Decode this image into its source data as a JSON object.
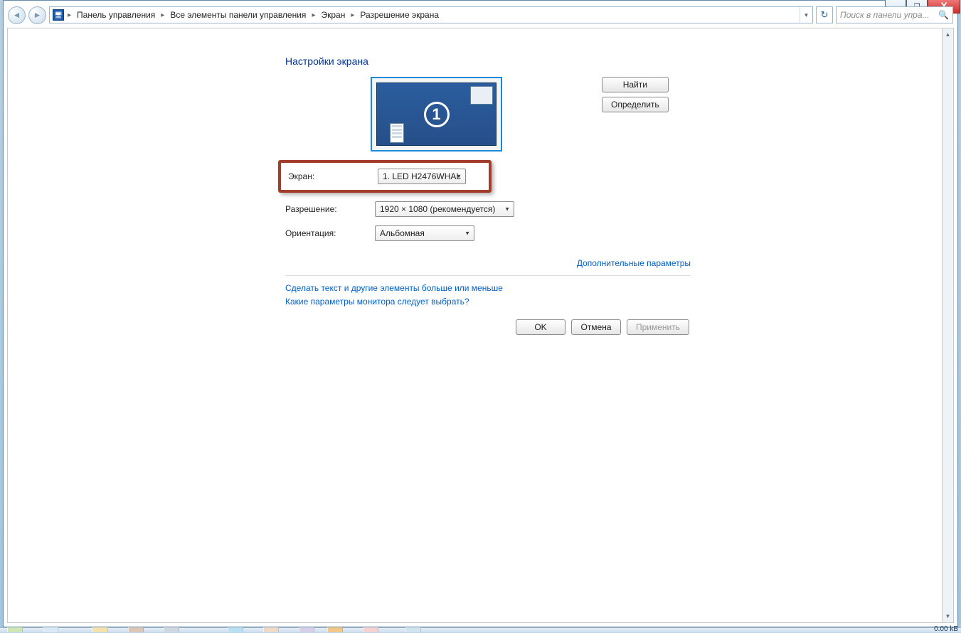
{
  "window": {
    "minimize": "–",
    "restore": "❐",
    "close": "X"
  },
  "breadcrumb": {
    "items": [
      "Панель управления",
      "Все элементы панели управления",
      "Экран",
      "Разрешение экрана"
    ]
  },
  "search": {
    "placeholder": "Поиск в панели упра..."
  },
  "title": "Настройки экрана",
  "buttons": {
    "find": "Найти",
    "identify": "Определить",
    "ok": "OK",
    "cancel": "Отмена",
    "apply": "Применить"
  },
  "display_preview": {
    "number": "1"
  },
  "fields": {
    "screen_label": "Экран:",
    "screen_value": "1. LED H2476WHAL",
    "resolution_label": "Разрешение:",
    "resolution_value": "1920 × 1080 (рекомендуется)",
    "orientation_label": "Ориентация:",
    "orientation_value": "Альбомная"
  },
  "links": {
    "advanced": "Дополнительные параметры",
    "text_size": "Сделать текст и другие элементы больше или меньше",
    "help": "Какие параметры монитора следует выбрать?"
  },
  "status": "0.00 kB"
}
